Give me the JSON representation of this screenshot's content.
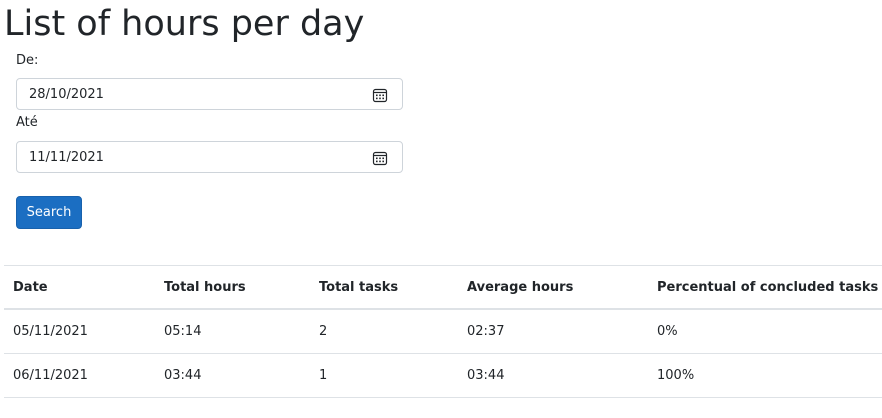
{
  "page": {
    "title": "List of hours per day"
  },
  "filters": {
    "from": {
      "label": "De:",
      "value": "28/10/2021",
      "icon": "calendar-icon"
    },
    "to": {
      "label": "Até",
      "value": "11/11/2021",
      "icon": "calendar-icon"
    },
    "search_label": "Search"
  },
  "table": {
    "headers": {
      "date": "Date",
      "total_hours": "Total hours",
      "total_tasks": "Total tasks",
      "average_hours": "Average hours",
      "percent_concluded": "Percentual of concluded tasks"
    },
    "rows": [
      {
        "date": "05/11/2021",
        "total_hours": "05:14",
        "total_tasks": "2",
        "average_hours": "02:37",
        "percent_concluded": "0%"
      },
      {
        "date": "06/11/2021",
        "total_hours": "03:44",
        "total_tasks": "1",
        "average_hours": "03:44",
        "percent_concluded": "100%"
      }
    ]
  },
  "colors": {
    "primary_button": "#1b6ec2",
    "text": "#212529",
    "border": "#dee2e6"
  }
}
